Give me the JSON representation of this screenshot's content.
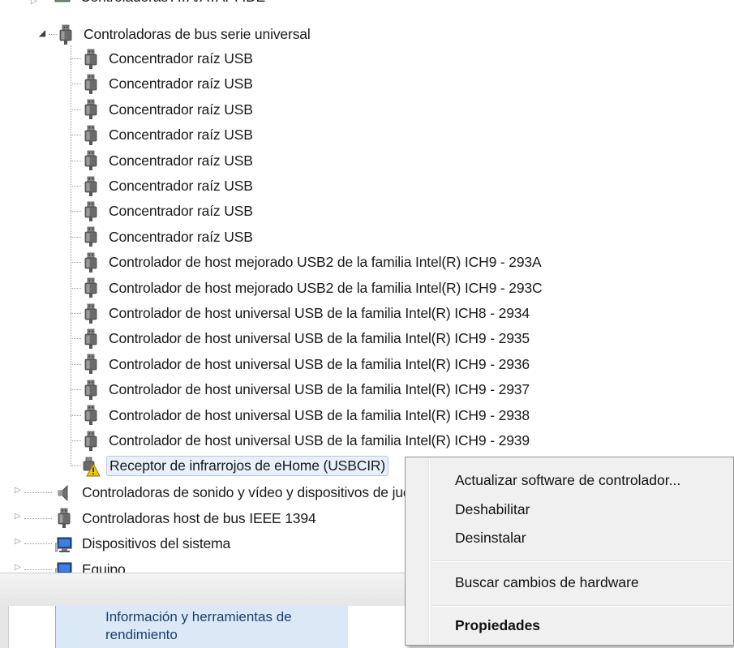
{
  "tree": {
    "partial_top_label": "Controladoras ATA/ATAPI IDE",
    "usb_category": "Controladoras de bus serie universal",
    "usb_children": [
      "Concentrador raíz USB",
      "Concentrador raíz USB",
      "Concentrador raíz USB",
      "Concentrador raíz USB",
      "Concentrador raíz USB",
      "Concentrador raíz USB",
      "Concentrador raíz USB",
      "Concentrador raíz USB",
      "Controlador de host mejorado USB2 de la familia Intel(R) ICH9 - 293A",
      "Controlador de host mejorado USB2 de la familia Intel(R) ICH9 - 293C",
      "Controlador de host universal USB de la familia Intel(R) ICH8 - 2934",
      "Controlador de host universal USB de la familia Intel(R) ICH9 - 2935",
      "Controlador de host universal USB de la familia Intel(R) ICH9 - 2936",
      "Controlador de host universal USB de la familia Intel(R) ICH9 - 2937",
      "Controlador de host universal USB de la familia Intel(R) ICH9 - 2938",
      "Controlador de host universal USB de la familia Intel(R) ICH9 - 2939"
    ],
    "selected_device": "Receptor de infrarrojos de eHome (USBCIR)",
    "categories_after": [
      {
        "label": "Controladoras de sonido y vídeo y dispositivos de juego",
        "icon": "speaker-icon"
      },
      {
        "label": "Controladoras host de bus IEEE 1394",
        "icon": "usb-plug-icon"
      },
      {
        "label": "Dispositivos del sistema",
        "icon": "computer-icon"
      },
      {
        "label": "Equipo",
        "icon": "computer-icon"
      }
    ]
  },
  "context_menu": {
    "update_driver": "Actualizar software de controlador...",
    "disable": "Deshabilitar",
    "uninstall": "Desinstalar",
    "scan_hardware": "Buscar cambios de hardware",
    "properties": "Propiedades"
  },
  "bottom_panel": {
    "link": "Información y herramientas de rendimiento"
  },
  "colors": {
    "selection_bg": "#e8f0fb",
    "warning": "#f2c511",
    "link": "#1c3f6e"
  }
}
